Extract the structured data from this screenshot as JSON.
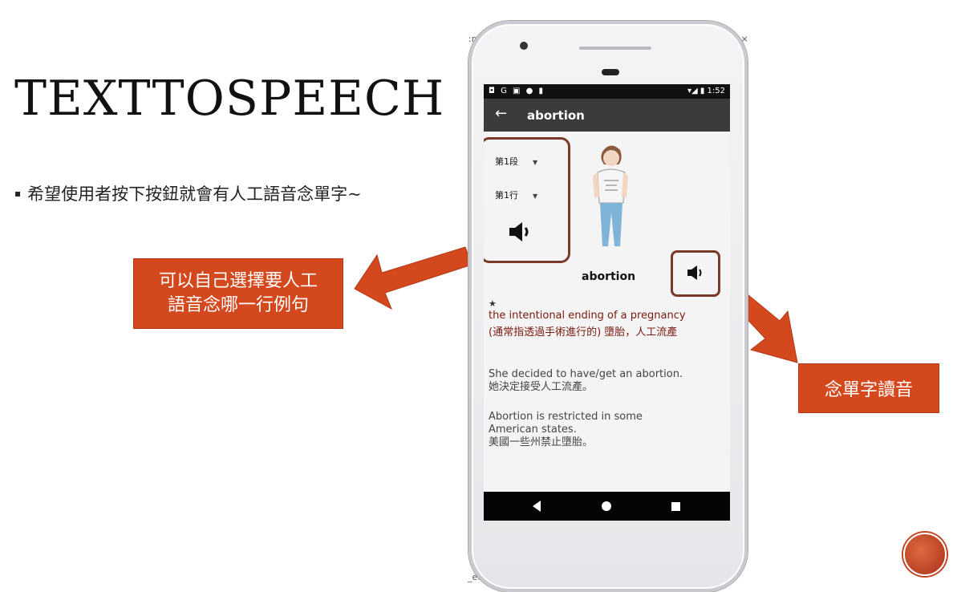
{
  "slide": {
    "title": "TEXTTOSPEECH",
    "bullet": "希望使用者按下按鈕就會有人工語音念單字~"
  },
  "callouts": {
    "left_line1": "可以自己選擇要人工",
    "left_line2": "語音念哪一行例句",
    "right": "念單字讀音"
  },
  "colors": {
    "accent": "#d4481e",
    "frame": "#7a3a2a",
    "app_bar": "#3b3b3b",
    "definition_text": "#7a1a0e"
  },
  "phone": {
    "status_time": "1:52",
    "app_title": "abortion",
    "segment_select": "第1段",
    "line_select": "第1行",
    "headword": "abortion",
    "star": "★",
    "definition_en": "the intentional ending of a pregnancy",
    "definition_zh": "(通常指透過手術進行的) 墮胎，人工流產",
    "examples": [
      {
        "en": "She decided to have/get an abortion.",
        "zh": "她決定接受人工流產。"
      },
      {
        "en_line1": "Abortion is restricted in some",
        "en_line2": "American states.",
        "zh": "美國一些州禁止墮胎。"
      }
    ],
    "icons": [
      "back-arrow-icon",
      "speaker-icon",
      "nav-back-icon",
      "nav-home-icon",
      "nav-recent-icon"
    ]
  },
  "peek": {
    "top_left": "ːml",
    "bottom_left": "_ec",
    "top_right": "l ×",
    "right_t": "t"
  }
}
